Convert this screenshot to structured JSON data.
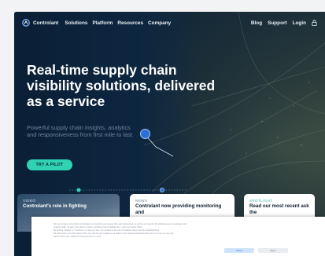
{
  "nav": {
    "brand": "Controlant",
    "links": [
      "Solutions",
      "Platform",
      "Resources",
      "Company"
    ],
    "right_links": [
      "Blog",
      "Support",
      "Login"
    ]
  },
  "hero": {
    "headline": "Real-time supply chain visibility solutions, delivered as a service",
    "subhead": "Powerful supply chain insights, analytics and responsiveness from first mile to last.",
    "cta": "TRY A PILOT"
  },
  "cards": [
    {
      "tag": "VIDEO",
      "title": "Controlant's role in fighting"
    },
    {
      "tag": "NEWS",
      "title": "Controlant now providing monitoring and"
    },
    {
      "tag": "SPOTLIGHT",
      "title": "Read our most recent ask the"
    }
  ],
  "cookie": {
    "lines": [
      "We use cookies and similar technologies to recognize your repeat visits and preferences, as well as to measure the effectiveness of campaigns and",
      "analyze traffic. To learn more about cookies, including how to disable them, view our Cookie Policy.",
      "By clicking \"Accept\" or \"Continue\" or using our site, you consent to the use of cookies unless you have disabled them.",
      "We also share your information when you visit this site to allow us to deliver more relevant advertisements; but if you opt out you may",
      "still be shown ads. Read the Privacy Notice for more."
    ],
    "accept": "Accept",
    "reject": "Reject"
  },
  "colors": {
    "background": "#0b1d33",
    "accent": "#2fd3b4",
    "play": "#2b6fd6"
  }
}
